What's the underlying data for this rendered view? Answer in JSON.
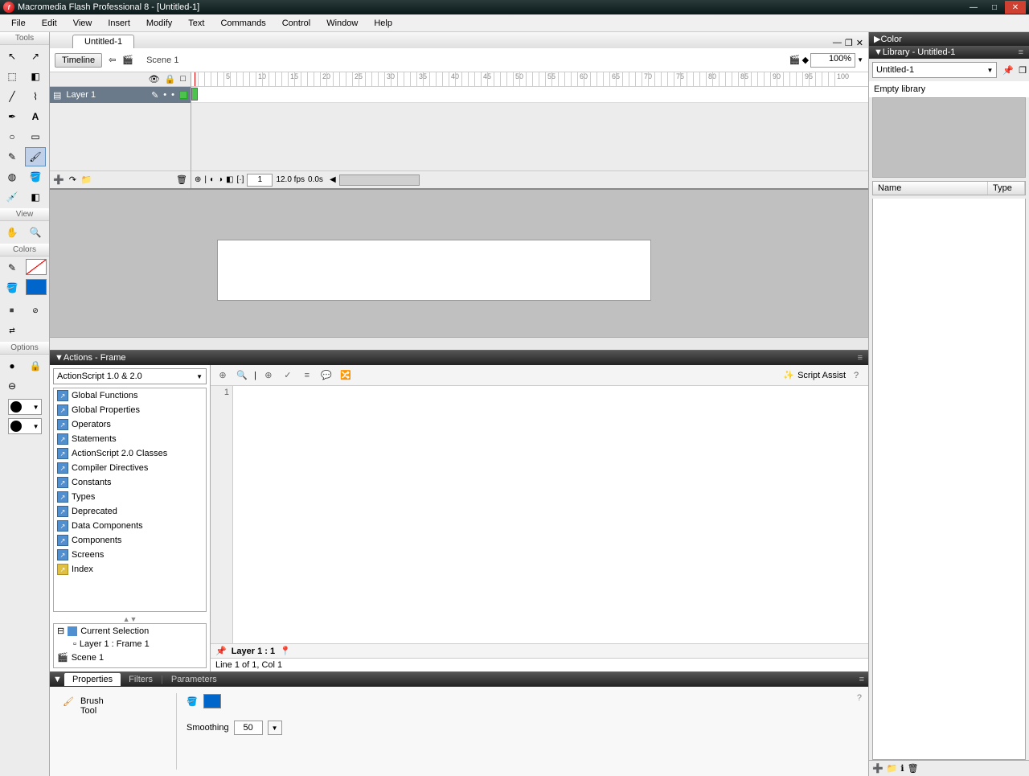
{
  "app": {
    "title": "Macromedia Flash Professional 8 - [Untitled-1]"
  },
  "menu": [
    "File",
    "Edit",
    "View",
    "Insert",
    "Modify",
    "Text",
    "Commands",
    "Control",
    "Window",
    "Help"
  ],
  "tools_panel": {
    "header": "Tools",
    "view_header": "View",
    "colors_header": "Colors",
    "options_header": "Options"
  },
  "doc": {
    "tab": "Untitled-1"
  },
  "timeline": {
    "button": "Timeline",
    "scene": "Scene 1",
    "zoom": "100%",
    "layer": "Layer 1",
    "frame": "1",
    "fps": "12.0 fps",
    "time": "0.0s"
  },
  "actions": {
    "title": "Actions - Frame",
    "version": "ActionScript 1.0 & 2.0",
    "script_assist": "Script Assist",
    "categories": [
      "Global Functions",
      "Global Properties",
      "Operators",
      "Statements",
      "ActionScript 2.0 Classes",
      "Compiler Directives",
      "Constants",
      "Types",
      "Deprecated",
      "Data Components",
      "Components",
      "Screens",
      "Index"
    ],
    "nav_current": "Current Selection",
    "nav_layer": "Layer 1 : Frame 1",
    "nav_scene": "Scene 1",
    "line_num": "1",
    "footer_label": "Layer 1 : 1",
    "status": "Line 1 of 1, Col 1"
  },
  "props": {
    "tabs": [
      "Properties",
      "Filters",
      "Parameters"
    ],
    "tool_name": "Brush",
    "tool_sub": "Tool",
    "smoothing_label": "Smoothing",
    "smoothing_value": "50"
  },
  "right": {
    "color_panel": "Color",
    "library_title": "Library - Untitled-1",
    "lib_doc": "Untitled-1",
    "empty_msg": "Empty library",
    "col_name": "Name",
    "col_type": "Type"
  }
}
